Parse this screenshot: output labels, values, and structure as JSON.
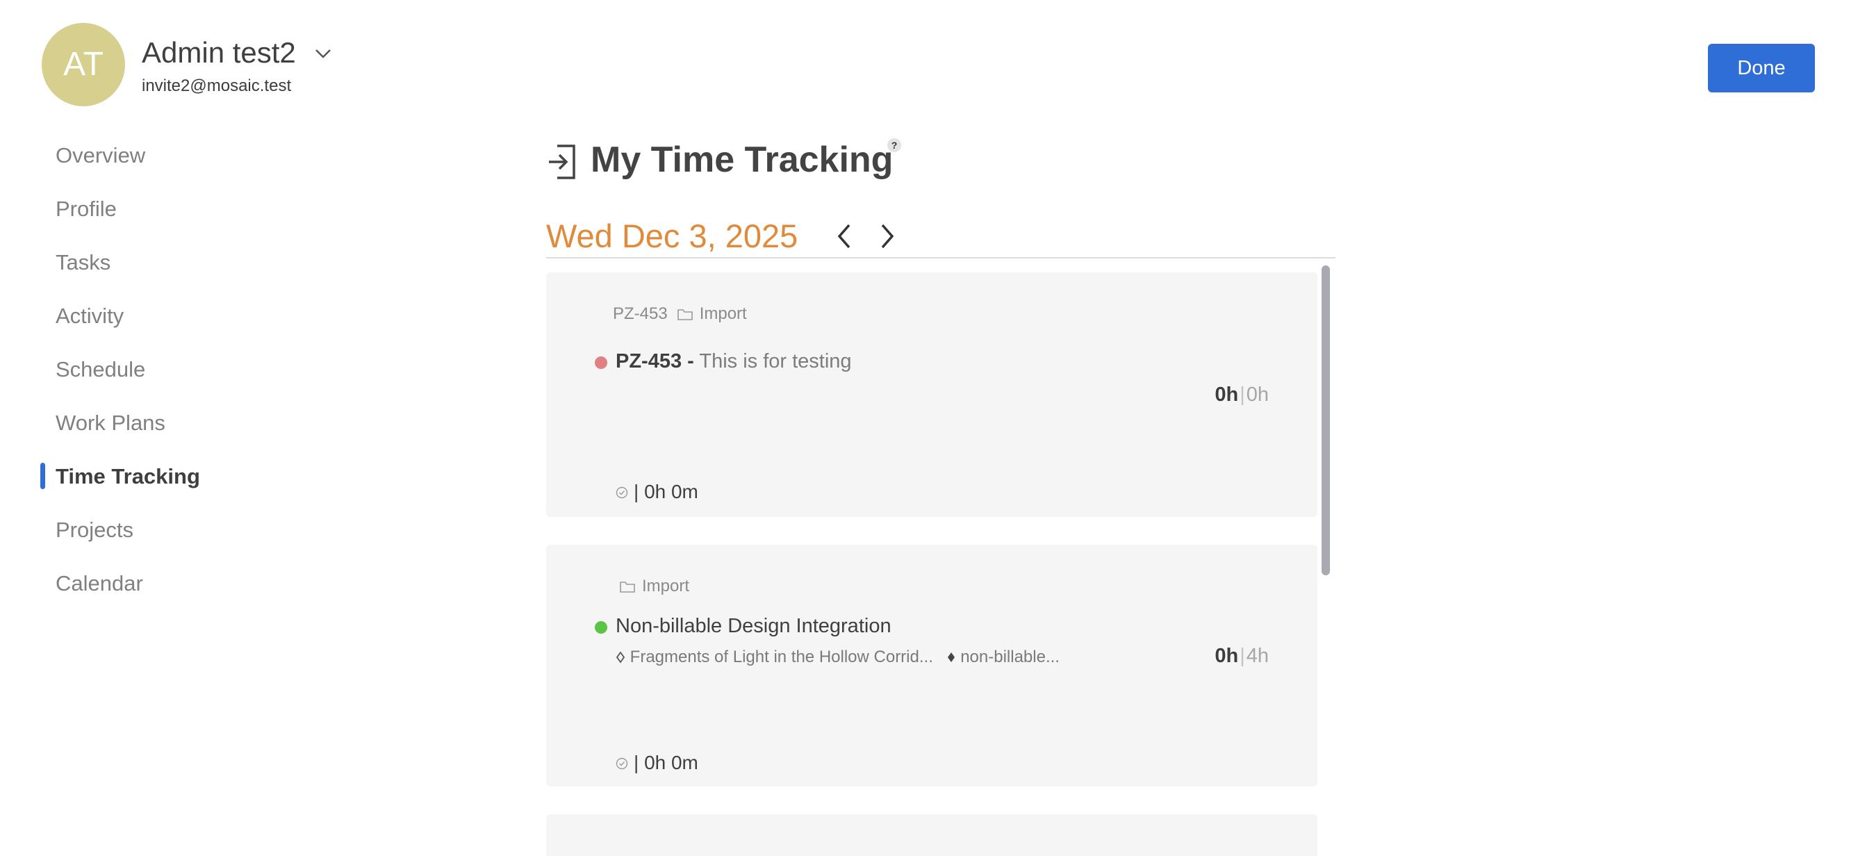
{
  "user": {
    "initials": "AT",
    "name": "Admin test2",
    "email": "invite2@mosaic.test"
  },
  "actions": {
    "done_label": "Done"
  },
  "sidebar": {
    "items": [
      {
        "label": "Overview",
        "active": false
      },
      {
        "label": "Profile",
        "active": false
      },
      {
        "label": "Tasks",
        "active": false
      },
      {
        "label": "Activity",
        "active": false
      },
      {
        "label": "Schedule",
        "active": false
      },
      {
        "label": "Work Plans",
        "active": false
      },
      {
        "label": "Time Tracking",
        "active": true
      },
      {
        "label": "Projects",
        "active": false
      },
      {
        "label": "Calendar",
        "active": false
      }
    ]
  },
  "main": {
    "title": "My Time Tracking",
    "help_badge": "?",
    "date": "Wed Dec 3, 2025",
    "entries": [
      {
        "code": "PZ-453",
        "project": "Import",
        "status_color": "#e08080",
        "title_code": "PZ-453 -",
        "title": "This is for testing",
        "phase": "",
        "work_category": "",
        "actual_hours": "0h",
        "separator": "|",
        "planned_hours": "0h",
        "logged_separator": "|",
        "logged": "0h 0m"
      },
      {
        "code": "",
        "project": "Import",
        "status_color": "#5cc444",
        "title_code": "",
        "title": "Non-billable Design Integration",
        "phase": "Fragments of Light in the Hollow Corrid...",
        "work_category": "non-billable...",
        "actual_hours": "0h",
        "separator": "|",
        "planned_hours": "4h",
        "logged_separator": "|",
        "logged": "0h 0m"
      }
    ]
  },
  "colors": {
    "accent_blue": "#2f6ed6",
    "date_orange": "#e08a3c",
    "avatar_bg": "#d6cf8e",
    "card_bg": "#f5f5f5"
  },
  "icons": {
    "user_menu": "chevron-down-icon",
    "title": "login-arrow-icon",
    "prev": "chevron-left-icon",
    "next": "chevron-right-icon",
    "project": "folder-icon",
    "phase": "diamond-outline-icon",
    "work_category": "diamond-filled-icon",
    "timer": "check-circle-icon"
  }
}
